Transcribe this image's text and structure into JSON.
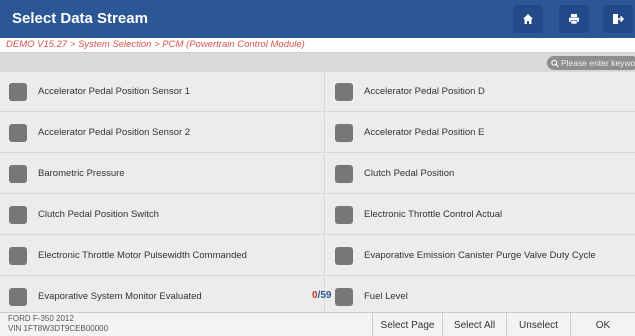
{
  "window": {
    "title": "Select Data Stream",
    "toolbar": {
      "icons": [
        "home-icon",
        "print-icon",
        "exit-icon"
      ]
    }
  },
  "breadcrumb": "DEMO V15.27 > System Selection > PCM (Powertrain Control Module)",
  "search": {
    "placeholder": "Please enter keyword"
  },
  "items": [
    {
      "label": "Accelerator Pedal Position Sensor 1",
      "checked": false
    },
    {
      "label": "Accelerator Pedal Position D",
      "checked": false
    },
    {
      "label": "Accelerator Pedal Position Sensor 2",
      "checked": false
    },
    {
      "label": "Accelerator Pedal Position E",
      "checked": false
    },
    {
      "label": "Barometric Pressure",
      "checked": false
    },
    {
      "label": "Clutch Pedal Position",
      "checked": false
    },
    {
      "label": "Clutch Pedal Position Switch",
      "checked": false
    },
    {
      "label": "Electronic Throttle Control Actual",
      "checked": false
    },
    {
      "label": "Electronic Throttle Motor Pulsewidth Commanded",
      "checked": false
    },
    {
      "label": "Evaporative Emission Canister Purge Valve Duty Cycle",
      "checked": false
    },
    {
      "label": "Evaporative System Monitor Evaluated",
      "checked": false
    },
    {
      "label": "Fuel Level",
      "checked": false
    }
  ],
  "counter": {
    "selected": "0",
    "separator": "/",
    "total": "59"
  },
  "vehicle": {
    "model": "FORD F-350 2012",
    "vin": "VIN 1FT8W3DT9CEB00000"
  },
  "buttons": {
    "select_page": "Select Page",
    "select_all": "Select All",
    "unselect": "Unselect",
    "ok": "OK"
  },
  "colors": {
    "titlebar": "#2c5796",
    "breadcrumb_text": "#d9534f",
    "checkbox": "#777777",
    "counter_selected": "#c0392b",
    "counter_total": "#2c5796"
  }
}
